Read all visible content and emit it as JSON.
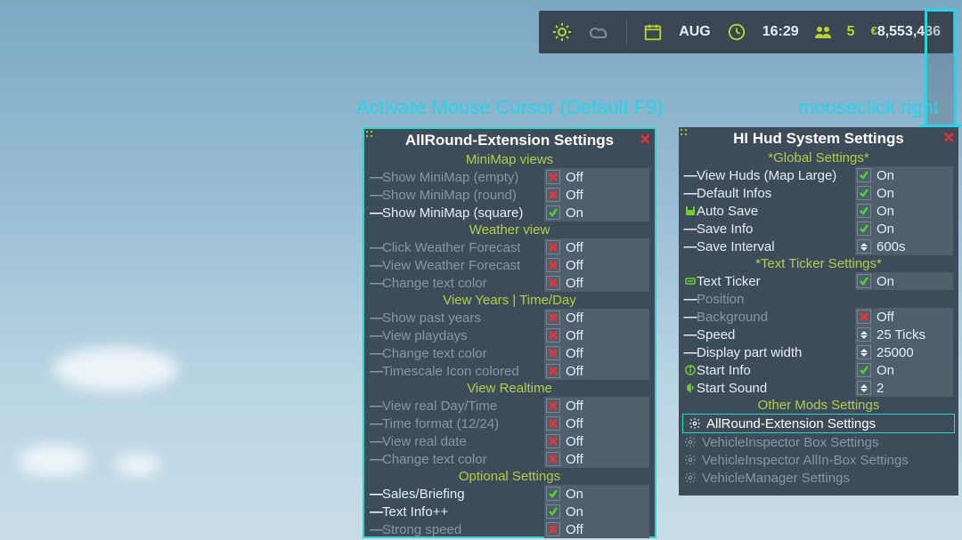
{
  "topbar": {
    "month": "AUG",
    "time": "16:29",
    "workers": "5",
    "money": "8,553,436",
    "currency": "€"
  },
  "annot": {
    "activate": "Activate Mouse Cursor (Default F9)",
    "rightclick": "mouseclick right"
  },
  "leftPanel": {
    "title": "AllRound-Extension Settings",
    "sections": [
      {
        "header": "MiniMap views",
        "rows": [
          {
            "label": "Show MiniMap (empty)",
            "type": "toggle",
            "value": "Off",
            "dim": true
          },
          {
            "label": "Show MiniMap (round)",
            "type": "toggle",
            "value": "Off",
            "dim": true
          },
          {
            "label": "Show MiniMap (square)",
            "type": "toggle",
            "value": "On",
            "dim": false
          }
        ]
      },
      {
        "header": "Weather view",
        "rows": [
          {
            "label": "Click Weather Forecast",
            "type": "toggle",
            "value": "Off",
            "dim": true
          },
          {
            "label": "View Weather Forecast",
            "type": "toggle",
            "value": "Off",
            "dim": true
          },
          {
            "label": "Change text color",
            "type": "toggle",
            "value": "Off",
            "dim": true
          }
        ]
      },
      {
        "header": "View Years | Time/Day",
        "rows": [
          {
            "label": "Show past years",
            "type": "toggle",
            "value": "Off",
            "dim": true
          },
          {
            "label": "View playdays",
            "type": "toggle",
            "value": "Off",
            "dim": true
          },
          {
            "label": "Change text color",
            "type": "toggle",
            "value": "Off",
            "dim": true
          },
          {
            "label": "Timescale Icon colored",
            "type": "toggle",
            "value": "Off",
            "dim": true
          }
        ]
      },
      {
        "header": "View Realtime",
        "rows": [
          {
            "label": "View real Day/Time",
            "type": "toggle",
            "value": "Off",
            "dim": true
          },
          {
            "label": "Time format (12/24)",
            "type": "toggle",
            "value": "Off",
            "dim": true
          },
          {
            "label": "View real date",
            "type": "toggle",
            "value": "Off",
            "dim": true
          },
          {
            "label": "Change text color",
            "type": "toggle",
            "value": "Off",
            "dim": true
          }
        ]
      },
      {
        "header": "Optional Settings",
        "rows": [
          {
            "label": "Sales/Briefing",
            "type": "toggle",
            "value": "On",
            "dim": false
          },
          {
            "label": "Text Info++",
            "type": "toggle",
            "value": "On",
            "dim": false
          },
          {
            "label": "Strong speed",
            "type": "toggle",
            "value": "Off",
            "dim": true
          }
        ]
      }
    ]
  },
  "rightPanel": {
    "title": "HI Hud System Settings",
    "sections": [
      {
        "header": "*Global Settings*",
        "rows": [
          {
            "label": "View Huds (Map Large)",
            "type": "toggle",
            "value": "On",
            "dim": false,
            "icon": "dash"
          },
          {
            "label": "Default Infos",
            "type": "toggle",
            "value": "On",
            "dim": false,
            "icon": "dash"
          },
          {
            "label": "Auto Save",
            "type": "toggle",
            "value": "On",
            "dim": false,
            "icon": "save"
          },
          {
            "label": "Save Info",
            "type": "toggle",
            "value": "On",
            "dim": false,
            "icon": "dash"
          },
          {
            "label": "Save Interval",
            "type": "spin",
            "value": "600s",
            "dim": false,
            "icon": "dash"
          }
        ]
      },
      {
        "header": "*Text Ticker Settings*",
        "rows": [
          {
            "label": "Text Ticker",
            "type": "toggle",
            "value": "On",
            "dim": false,
            "icon": "ticker"
          },
          {
            "label": "Position",
            "type": "none",
            "value": "",
            "dim": true,
            "icon": "dash"
          },
          {
            "label": "Background",
            "type": "toggle",
            "value": "Off",
            "dim": true,
            "icon": "dash"
          },
          {
            "label": "Speed",
            "type": "spin",
            "value": "25 Ticks",
            "dim": false,
            "icon": "dash"
          },
          {
            "label": "Display part width",
            "type": "spin",
            "value": "25000",
            "dim": false,
            "icon": "dash"
          },
          {
            "label": "Start Info",
            "type": "toggle",
            "value": "On",
            "dim": false,
            "icon": "info"
          },
          {
            "label": "Start Sound",
            "type": "spin",
            "value": "2",
            "dim": false,
            "icon": "sound"
          }
        ]
      }
    ],
    "otherHeader": "Other Mods Settings",
    "links": [
      {
        "label": "AllRound-Extension Settings",
        "active": true
      },
      {
        "label": "VehicleInspector Box Settings",
        "active": false
      },
      {
        "label": "VehicleInspector AllIn-Box Settings",
        "active": false
      },
      {
        "label": "VehicleManager Settings",
        "active": false
      }
    ]
  }
}
